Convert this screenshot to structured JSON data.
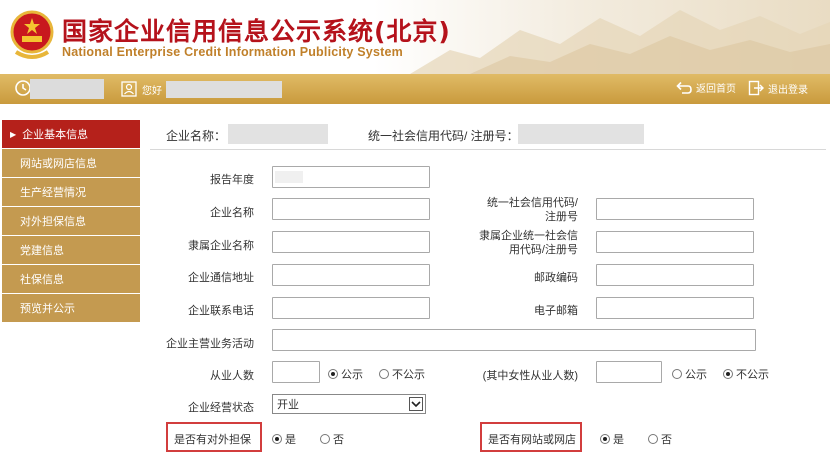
{
  "header": {
    "title_cn": "国家企业信用信息公示系统(北京)",
    "title_en": "National Enterprise Credit Information Publicity System"
  },
  "topbar": {
    "greeting": "您好",
    "home_label": "返回首页",
    "logout_label": "退出登录"
  },
  "sidebar": {
    "items": [
      {
        "label": "企业基本信息",
        "active": true
      },
      {
        "label": "网站或网店信息",
        "active": false
      },
      {
        "label": "生产经营情况",
        "active": false
      },
      {
        "label": "对外担保信息",
        "active": false
      },
      {
        "label": "党建信息",
        "active": false
      },
      {
        "label": "社保信息",
        "active": false
      },
      {
        "label": "预览并公示",
        "active": false
      }
    ]
  },
  "info": {
    "company_name_label": "企业名称：",
    "credit_code_label": "统一社会信用代码/ 注册号："
  },
  "form": {
    "report_year": "报告年度",
    "company_name": "企业名称",
    "credit_code_line1": "统一社会信用代码/",
    "credit_code_line2": "注册号",
    "parent_company": "隶属企业名称",
    "parent_code_line1": "隶属企业统一社会信",
    "parent_code_line2": "用代码/注册号",
    "address": "企业通信地址",
    "postcode": "邮政编码",
    "phone": "企业联系电话",
    "email": "电子邮箱",
    "business": "企业主营业务活动",
    "employees": "从业人数",
    "female_employees": "(其中女性从业人数)",
    "status_label": "企业经营状态",
    "status_value": "开业",
    "guarantee_label": "是否有对外担保",
    "website_label": "是否有网站或网店",
    "public": "公示",
    "not_public": "不公示",
    "yes": "是",
    "no": "否"
  },
  "colors": {
    "brand_red": "#b5121b",
    "gold": "#c99a3d",
    "sidebar_gold": "#c49a50",
    "highlight": "#d23d3d"
  }
}
